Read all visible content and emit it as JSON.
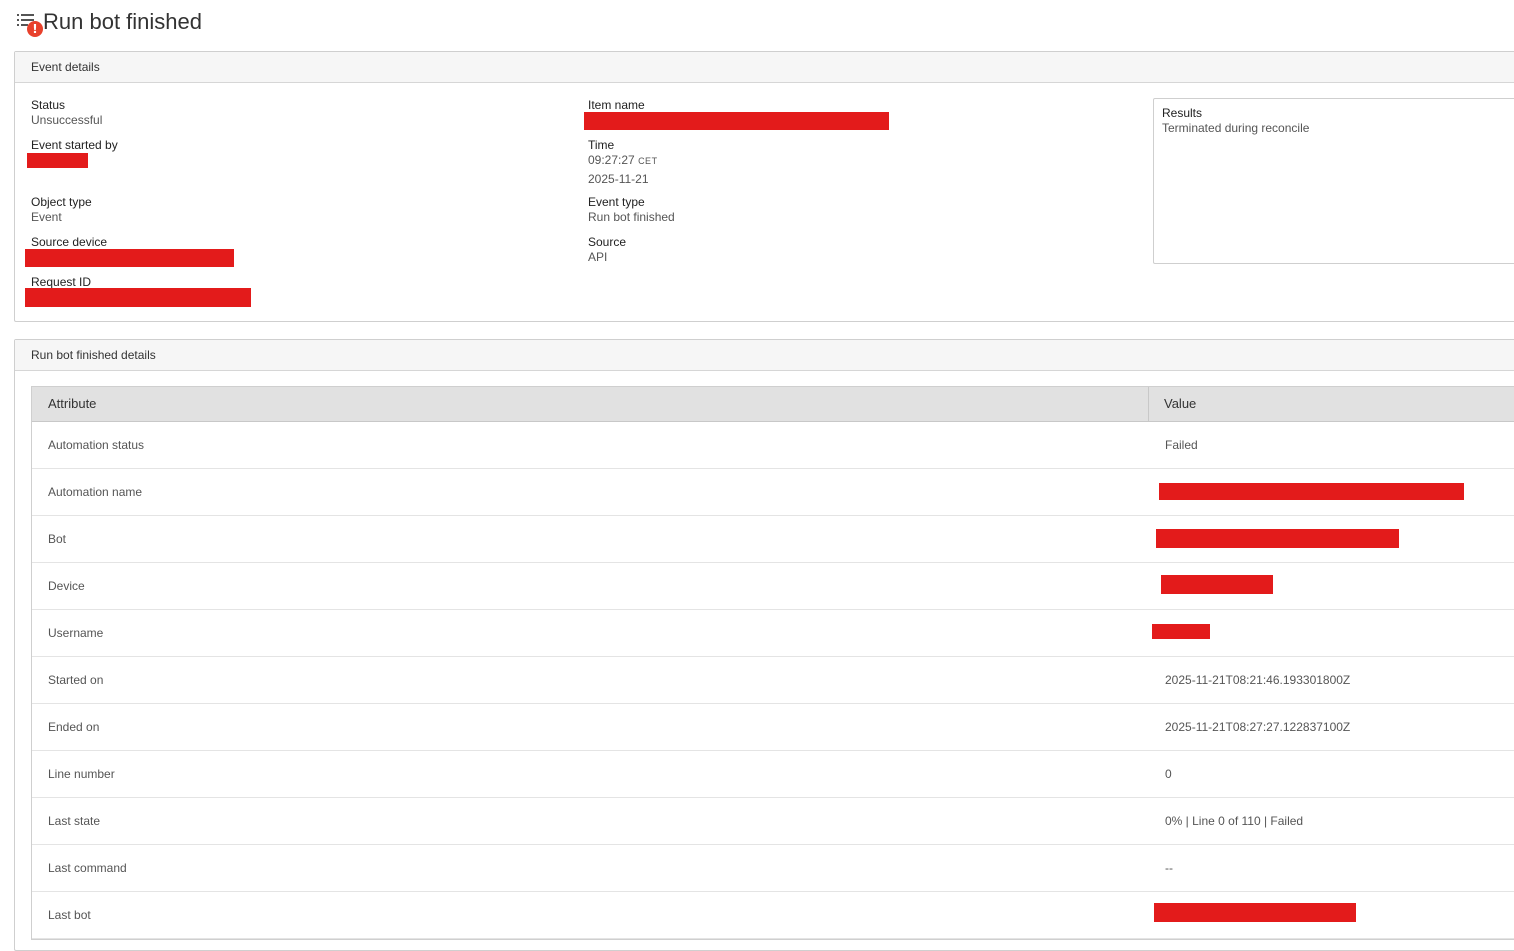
{
  "page": {
    "title": "Run bot finished",
    "icon": "list-icon",
    "badge_icon": "alert-icon",
    "badge_text": "!"
  },
  "event_details": {
    "header": "Event details",
    "status": {
      "label": "Status",
      "value": "Unsuccessful"
    },
    "event_started_by": {
      "label": "Event started by"
    },
    "object_type": {
      "label": "Object type",
      "value": "Event"
    },
    "source_device": {
      "label": "Source device"
    },
    "request_id": {
      "label": "Request ID"
    },
    "item_name": {
      "label": "Item name"
    },
    "time": {
      "label": "Time",
      "value": "09:27:27",
      "tz": "CET",
      "date": "2025-11-21"
    },
    "event_type": {
      "label": "Event type",
      "value": "Run bot finished"
    },
    "source": {
      "label": "Source",
      "value": "API"
    },
    "results": {
      "label": "Results",
      "value": "Terminated during reconcile"
    }
  },
  "details": {
    "header": "Run bot finished details",
    "columns": [
      "Attribute",
      "Value"
    ],
    "rows": [
      {
        "attribute": "Automation status",
        "value": "Failed"
      },
      {
        "attribute": "Automation name",
        "value": ""
      },
      {
        "attribute": "Bot",
        "value": ""
      },
      {
        "attribute": "Device",
        "value": ""
      },
      {
        "attribute": "Username",
        "value": ""
      },
      {
        "attribute": "Started on",
        "value": "2025-11-21T08:21:46.193301800Z"
      },
      {
        "attribute": "Ended on",
        "value": "2025-11-21T08:27:27.122837100Z"
      },
      {
        "attribute": "Line number",
        "value": "0"
      },
      {
        "attribute": "Last state",
        "value": "0% | Line 0 of 110 | Failed"
      },
      {
        "attribute": "Last command",
        "value": "--"
      },
      {
        "attribute": "Last bot",
        "value": ""
      }
    ]
  },
  "colors": {
    "redaction": "#e31b1b",
    "alert": "#e8412c",
    "header_bg": "#f6f6f6",
    "table_header_bg": "#e1e1e1"
  }
}
